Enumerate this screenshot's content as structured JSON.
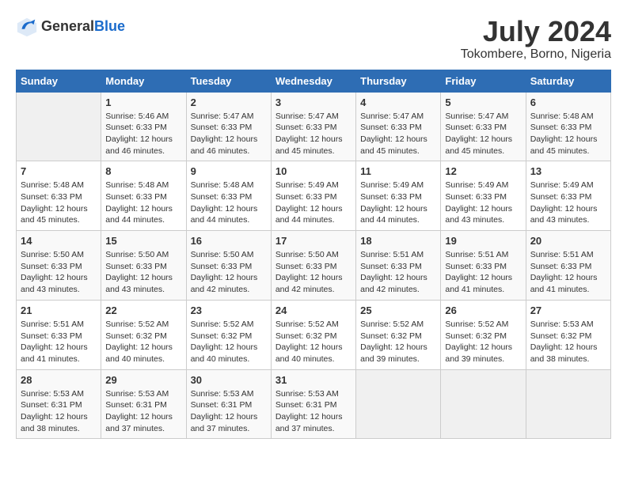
{
  "logo": {
    "text_general": "General",
    "text_blue": "Blue"
  },
  "title": "July 2024",
  "subtitle": "Tokombere, Borno, Nigeria",
  "days_of_week": [
    "Sunday",
    "Monday",
    "Tuesday",
    "Wednesday",
    "Thursday",
    "Friday",
    "Saturday"
  ],
  "weeks": [
    [
      {
        "day": "",
        "sunrise": "",
        "sunset": "",
        "daylight": "",
        "empty": true
      },
      {
        "day": "1",
        "sunrise": "Sunrise: 5:46 AM",
        "sunset": "Sunset: 6:33 PM",
        "daylight": "Daylight: 12 hours and 46 minutes."
      },
      {
        "day": "2",
        "sunrise": "Sunrise: 5:47 AM",
        "sunset": "Sunset: 6:33 PM",
        "daylight": "Daylight: 12 hours and 46 minutes."
      },
      {
        "day": "3",
        "sunrise": "Sunrise: 5:47 AM",
        "sunset": "Sunset: 6:33 PM",
        "daylight": "Daylight: 12 hours and 45 minutes."
      },
      {
        "day": "4",
        "sunrise": "Sunrise: 5:47 AM",
        "sunset": "Sunset: 6:33 PM",
        "daylight": "Daylight: 12 hours and 45 minutes."
      },
      {
        "day": "5",
        "sunrise": "Sunrise: 5:47 AM",
        "sunset": "Sunset: 6:33 PM",
        "daylight": "Daylight: 12 hours and 45 minutes."
      },
      {
        "day": "6",
        "sunrise": "Sunrise: 5:48 AM",
        "sunset": "Sunset: 6:33 PM",
        "daylight": "Daylight: 12 hours and 45 minutes."
      }
    ],
    [
      {
        "day": "7",
        "sunrise": "Sunrise: 5:48 AM",
        "sunset": "Sunset: 6:33 PM",
        "daylight": "Daylight: 12 hours and 45 minutes."
      },
      {
        "day": "8",
        "sunrise": "Sunrise: 5:48 AM",
        "sunset": "Sunset: 6:33 PM",
        "daylight": "Daylight: 12 hours and 44 minutes."
      },
      {
        "day": "9",
        "sunrise": "Sunrise: 5:48 AM",
        "sunset": "Sunset: 6:33 PM",
        "daylight": "Daylight: 12 hours and 44 minutes."
      },
      {
        "day": "10",
        "sunrise": "Sunrise: 5:49 AM",
        "sunset": "Sunset: 6:33 PM",
        "daylight": "Daylight: 12 hours and 44 minutes."
      },
      {
        "day": "11",
        "sunrise": "Sunrise: 5:49 AM",
        "sunset": "Sunset: 6:33 PM",
        "daylight": "Daylight: 12 hours and 44 minutes."
      },
      {
        "day": "12",
        "sunrise": "Sunrise: 5:49 AM",
        "sunset": "Sunset: 6:33 PM",
        "daylight": "Daylight: 12 hours and 43 minutes."
      },
      {
        "day": "13",
        "sunrise": "Sunrise: 5:49 AM",
        "sunset": "Sunset: 6:33 PM",
        "daylight": "Daylight: 12 hours and 43 minutes."
      }
    ],
    [
      {
        "day": "14",
        "sunrise": "Sunrise: 5:50 AM",
        "sunset": "Sunset: 6:33 PM",
        "daylight": "Daylight: 12 hours and 43 minutes."
      },
      {
        "day": "15",
        "sunrise": "Sunrise: 5:50 AM",
        "sunset": "Sunset: 6:33 PM",
        "daylight": "Daylight: 12 hours and 43 minutes."
      },
      {
        "day": "16",
        "sunrise": "Sunrise: 5:50 AM",
        "sunset": "Sunset: 6:33 PM",
        "daylight": "Daylight: 12 hours and 42 minutes."
      },
      {
        "day": "17",
        "sunrise": "Sunrise: 5:50 AM",
        "sunset": "Sunset: 6:33 PM",
        "daylight": "Daylight: 12 hours and 42 minutes."
      },
      {
        "day": "18",
        "sunrise": "Sunrise: 5:51 AM",
        "sunset": "Sunset: 6:33 PM",
        "daylight": "Daylight: 12 hours and 42 minutes."
      },
      {
        "day": "19",
        "sunrise": "Sunrise: 5:51 AM",
        "sunset": "Sunset: 6:33 PM",
        "daylight": "Daylight: 12 hours and 41 minutes."
      },
      {
        "day": "20",
        "sunrise": "Sunrise: 5:51 AM",
        "sunset": "Sunset: 6:33 PM",
        "daylight": "Daylight: 12 hours and 41 minutes."
      }
    ],
    [
      {
        "day": "21",
        "sunrise": "Sunrise: 5:51 AM",
        "sunset": "Sunset: 6:33 PM",
        "daylight": "Daylight: 12 hours and 41 minutes."
      },
      {
        "day": "22",
        "sunrise": "Sunrise: 5:52 AM",
        "sunset": "Sunset: 6:32 PM",
        "daylight": "Daylight: 12 hours and 40 minutes."
      },
      {
        "day": "23",
        "sunrise": "Sunrise: 5:52 AM",
        "sunset": "Sunset: 6:32 PM",
        "daylight": "Daylight: 12 hours and 40 minutes."
      },
      {
        "day": "24",
        "sunrise": "Sunrise: 5:52 AM",
        "sunset": "Sunset: 6:32 PM",
        "daylight": "Daylight: 12 hours and 40 minutes."
      },
      {
        "day": "25",
        "sunrise": "Sunrise: 5:52 AM",
        "sunset": "Sunset: 6:32 PM",
        "daylight": "Daylight: 12 hours and 39 minutes."
      },
      {
        "day": "26",
        "sunrise": "Sunrise: 5:52 AM",
        "sunset": "Sunset: 6:32 PM",
        "daylight": "Daylight: 12 hours and 39 minutes."
      },
      {
        "day": "27",
        "sunrise": "Sunrise: 5:53 AM",
        "sunset": "Sunset: 6:32 PM",
        "daylight": "Daylight: 12 hours and 38 minutes."
      }
    ],
    [
      {
        "day": "28",
        "sunrise": "Sunrise: 5:53 AM",
        "sunset": "Sunset: 6:31 PM",
        "daylight": "Daylight: 12 hours and 38 minutes."
      },
      {
        "day": "29",
        "sunrise": "Sunrise: 5:53 AM",
        "sunset": "Sunset: 6:31 PM",
        "daylight": "Daylight: 12 hours and 37 minutes."
      },
      {
        "day": "30",
        "sunrise": "Sunrise: 5:53 AM",
        "sunset": "Sunset: 6:31 PM",
        "daylight": "Daylight: 12 hours and 37 minutes."
      },
      {
        "day": "31",
        "sunrise": "Sunrise: 5:53 AM",
        "sunset": "Sunset: 6:31 PM",
        "daylight": "Daylight: 12 hours and 37 minutes."
      },
      {
        "day": "",
        "sunrise": "",
        "sunset": "",
        "daylight": "",
        "empty": true
      },
      {
        "day": "",
        "sunrise": "",
        "sunset": "",
        "daylight": "",
        "empty": true
      },
      {
        "day": "",
        "sunrise": "",
        "sunset": "",
        "daylight": "",
        "empty": true
      }
    ]
  ]
}
